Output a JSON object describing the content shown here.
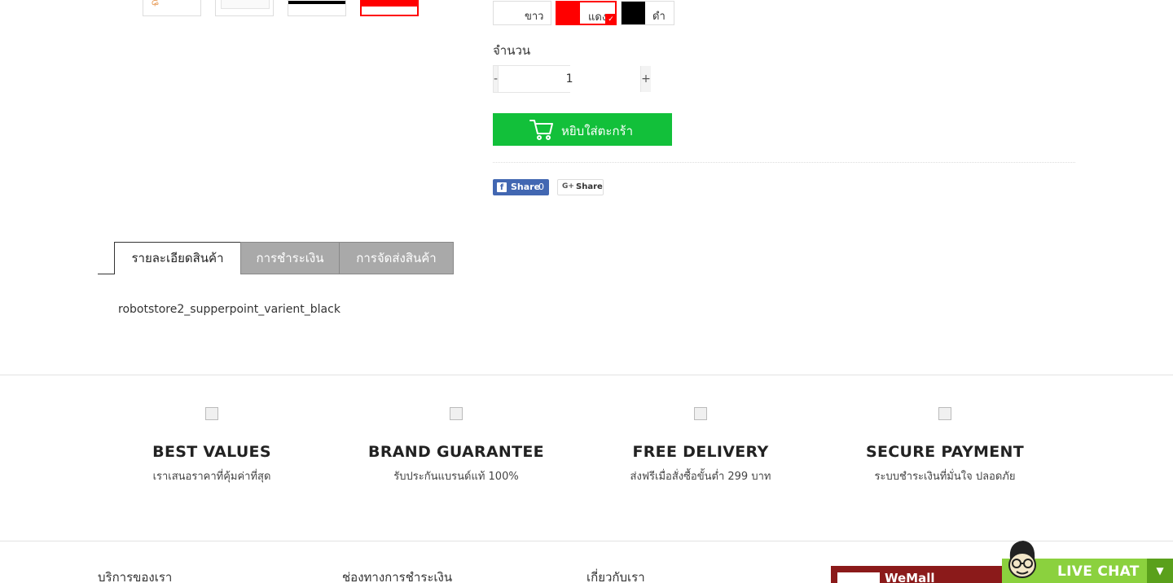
{
  "variants": {
    "colors": [
      {
        "label": "ขาว",
        "swatch": "#ffffff",
        "selected": false
      },
      {
        "label": "แดง",
        "swatch": "#ff0000",
        "selected": true
      },
      {
        "label": "ดำ",
        "swatch": "#000000",
        "selected": false
      }
    ],
    "selected_check": "✓"
  },
  "quantity": {
    "label": "จำนวน",
    "minus": "-",
    "value": "1",
    "plus": "+"
  },
  "cart": {
    "label": "หยิบใส่ตะกร้า",
    "color": "#12c03a"
  },
  "share": {
    "facebook_label": "Share",
    "facebook_count": "0",
    "facebook_icon": "f",
    "google_label": "Share",
    "google_icon": "G+"
  },
  "tabs": [
    {
      "label": "รายละเอียดสินค้า",
      "active": true
    },
    {
      "label": "การชำระเงิน",
      "active": false
    },
    {
      "label": "การจัดส่งสินค้า",
      "active": false
    }
  ],
  "description": "robotstore2_supperpoint_varient_black",
  "features": [
    {
      "title": "BEST VALUES",
      "subtitle": "เราเสนอราคาที่คุ้มค่าที่สุด"
    },
    {
      "title": "BRAND GUARANTEE",
      "subtitle": "รับประกันแบรนด์แท้ 100%"
    },
    {
      "title": "FREE DELIVERY",
      "subtitle": "ส่งฟรีเมื่อสั่งซื้อขั้นต่ำ 299 บาท"
    },
    {
      "title": "SECURE PAYMENT",
      "subtitle": "ระบบชำระเงินที่มั่นใจ ปลอดภัย"
    }
  ],
  "footer": {
    "columns": [
      "บริการของเรา",
      "ช่องทางการชำระเงิน",
      "เกี่ยวกับเรา"
    ],
    "fb_page_name": "WeMall"
  },
  "live_chat": {
    "label": "LIVE CHAT",
    "toggle": "▼",
    "color": "#8bd13e"
  }
}
